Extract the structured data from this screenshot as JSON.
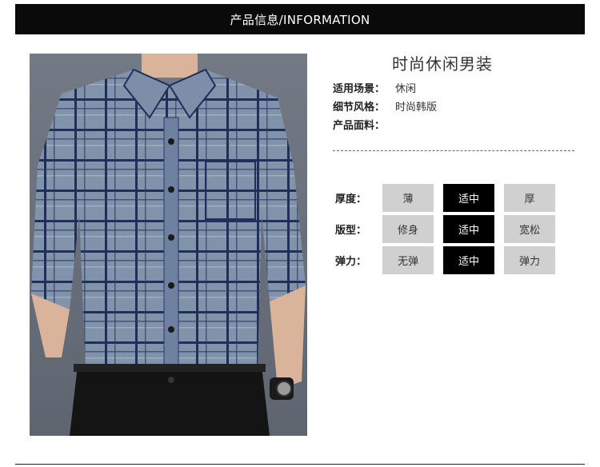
{
  "header": {
    "title": "产品信息/INFORMATION"
  },
  "product": {
    "title": "时尚休闲男装",
    "info": [
      {
        "label": "适用场景：",
        "value": "休闲"
      },
      {
        "label": "细节风格：",
        "value": "时尚韩版"
      },
      {
        "label": "产品面料：",
        "value": ""
      }
    ]
  },
  "attributes": [
    {
      "label": "厚度：",
      "options": [
        "薄",
        "适中",
        "厚"
      ],
      "selected": 1
    },
    {
      "label": "版型：",
      "options": [
        "修身",
        "适中",
        "宽松"
      ],
      "selected": 1
    },
    {
      "label": "弹力：",
      "options": [
        "无弹",
        "适中",
        "弹力"
      ],
      "selected": 1
    }
  ],
  "colors": {
    "header_bg": "#0a0a0a",
    "cell_bg": "#d0d0d0",
    "active_bg": "#000000",
    "shirt": "#7d8fa8",
    "check": "#1f2f5a"
  }
}
